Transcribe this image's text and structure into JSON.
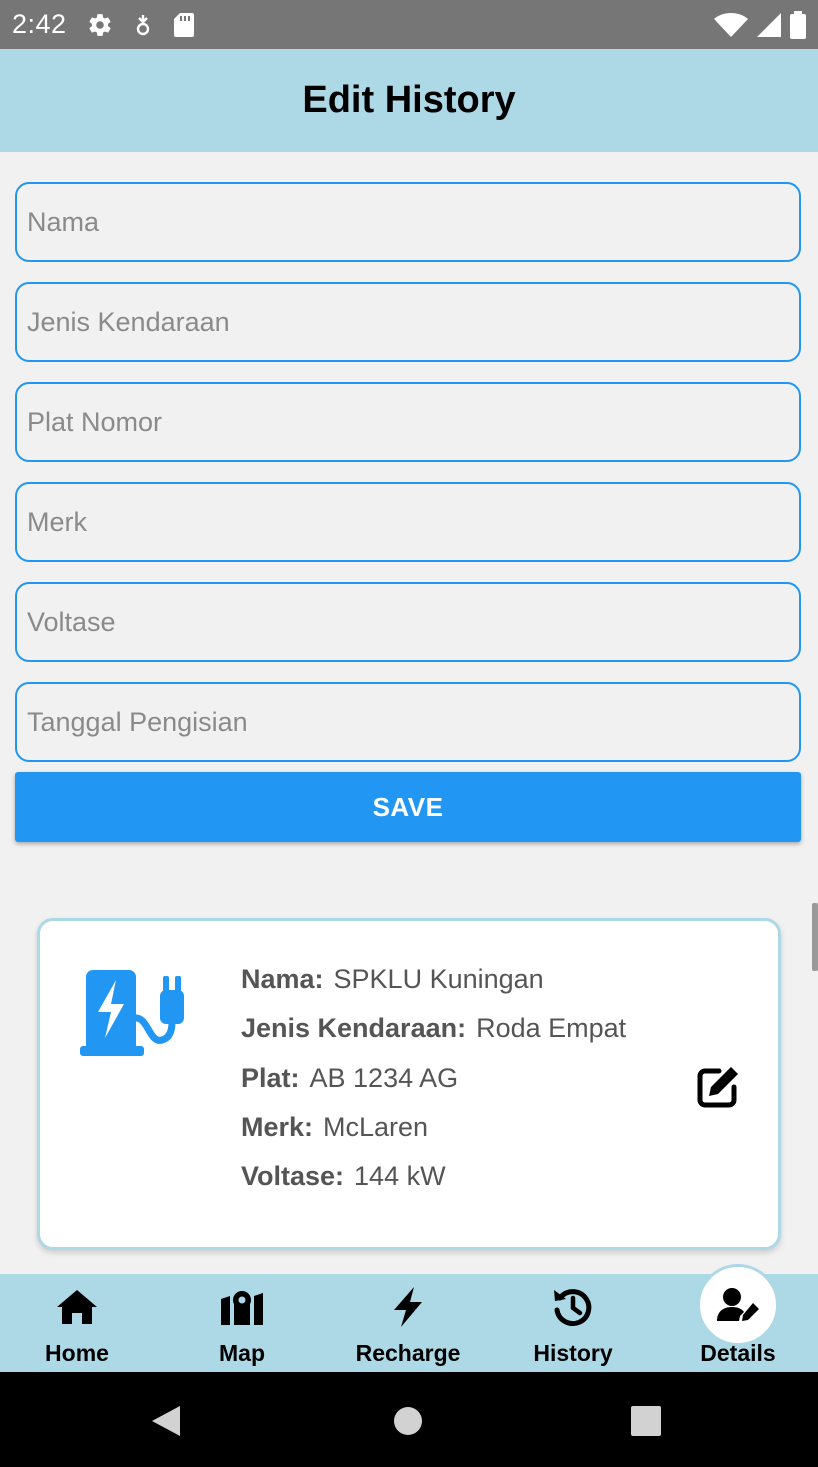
{
  "status_bar": {
    "time": "2:42",
    "icons": [
      "gear-icon",
      "data-saver-icon",
      "sd-card-icon",
      "wifi-icon",
      "signal-icon",
      "battery-icon"
    ]
  },
  "app_bar": {
    "title": "Edit History"
  },
  "form": {
    "fields": [
      {
        "placeholder": "Nama",
        "value": ""
      },
      {
        "placeholder": "Jenis Kendaraan",
        "value": ""
      },
      {
        "placeholder": "Plat Nomor",
        "value": ""
      },
      {
        "placeholder": "Merk",
        "value": ""
      },
      {
        "placeholder": "Voltase",
        "value": ""
      },
      {
        "placeholder": "Tanggal Pengisian",
        "value": ""
      }
    ],
    "save_label": "SAVE"
  },
  "card": {
    "icon": "ev-charger-icon",
    "rows": [
      {
        "key": "Nama:",
        "value": "SPKLU Kuningan"
      },
      {
        "key": "Jenis Kendaraan:",
        "value": "Roda Empat"
      },
      {
        "key": "Plat:",
        "value": "AB 1234 AG"
      },
      {
        "key": "Merk:",
        "value": "McLaren"
      },
      {
        "key": "Voltase:",
        "value": "144 kW"
      }
    ],
    "edit_icon": "edit-icon"
  },
  "bottom_nav": {
    "items": [
      {
        "label": "Home",
        "icon": "home-icon"
      },
      {
        "label": "Map",
        "icon": "map-icon"
      },
      {
        "label": "Recharge",
        "icon": "bolt-icon"
      },
      {
        "label": "History",
        "icon": "history-icon"
      },
      {
        "label": "Details",
        "icon": "user-edit-icon"
      }
    ],
    "active": "Details"
  },
  "colors": {
    "app_bar": "#add8e6",
    "accent": "#2196f3",
    "status_bar": "#767676",
    "text_secondary": "#555555"
  }
}
